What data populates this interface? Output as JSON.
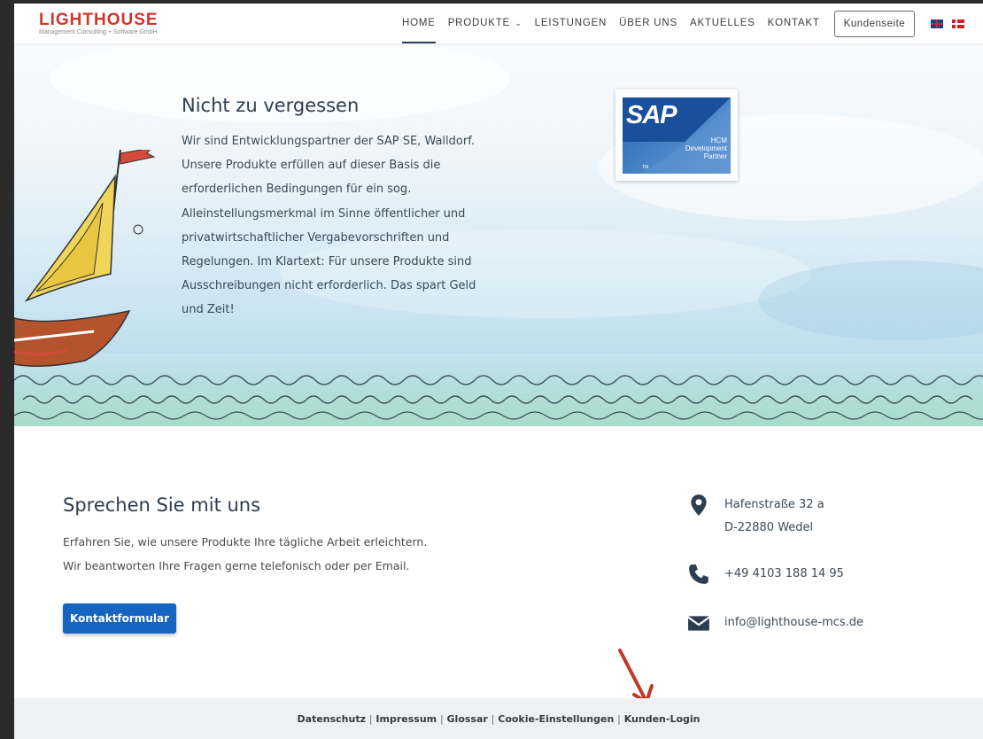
{
  "header": {
    "logo_text": "LIGHTHOUSE",
    "logo_subtitle": "Management Consulting + Software GmbH",
    "nav": [
      {
        "label": "HOME",
        "active": true
      },
      {
        "label": "PRODUKTE",
        "has_dropdown": true
      },
      {
        "label": "LEISTUNGEN"
      },
      {
        "label": "ÜBER UNS"
      },
      {
        "label": "AKTUELLES"
      },
      {
        "label": "KONTAKT"
      }
    ],
    "kunden_button": "Kundenseite",
    "language_flags": [
      "uk-flag-icon",
      "dk-flag-icon"
    ]
  },
  "hero": {
    "title": "Nicht zu vergessen",
    "body_lines": [
      "Wir sind Entwicklungspartner der SAP SE, Walldorf.",
      "Unsere Produkte erfüllen auf dieser Basis die",
      "erforderlichen Bedingungen für ein sog.",
      "Alleinstellungsmerkmal im Sinne öffentlicher und",
      "privatwirtschaftlicher Vergabevorschriften und",
      "Regelungen. Im Klartext: Für unsere Produkte sind",
      "Ausschreibungen nicht erforderlich. Das spart Geld",
      "und Zeit!"
    ],
    "badge": {
      "brand": "SAP",
      "line1": "HCM",
      "line2": "Development",
      "line3": "Partner",
      "tm": "TM"
    }
  },
  "contact": {
    "title": "Sprechen Sie mit uns",
    "line1": "Erfahren Sie, wie unsere Produkte Ihre tägliche Arbeit erleichtern.",
    "line2": "Wir beantworten Ihre Fragen gerne telefonisch oder per Email.",
    "button": "Kontaktformular",
    "address_line1": "Hafenstraße 32 a",
    "address_line2": "D-22880 Wedel",
    "phone": "+49 4103 188 14 95",
    "email": "info@lighthouse-mcs.de"
  },
  "footer": {
    "links": [
      "Datenschutz",
      "Impressum",
      "Glossar",
      "Cookie-Einstellungen",
      "Kunden-Login"
    ],
    "separator": "|"
  },
  "colors": {
    "brand_red": "#d1362c",
    "heading": "#2d3e50",
    "button_blue": "#1565c0",
    "arrow_red": "#c0392b"
  }
}
